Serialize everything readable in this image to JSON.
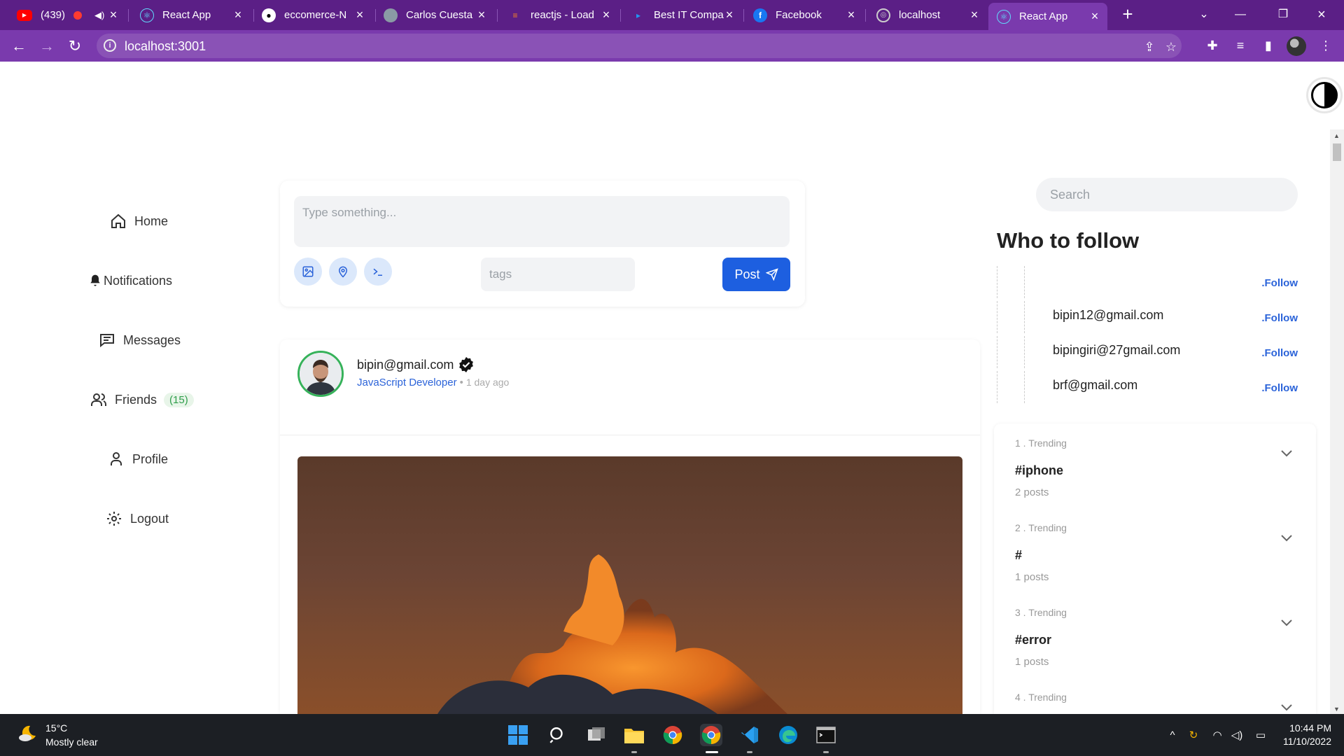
{
  "browser": {
    "tabs": [
      {
        "title": "(439)",
        "icon": "youtube-icon"
      },
      {
        "title": "React App",
        "icon": "react-icon"
      },
      {
        "title": "eccomerce-N",
        "icon": "github-icon"
      },
      {
        "title": "Carlos Cuesta",
        "icon": "avatar-icon"
      },
      {
        "title": "reactjs - Load",
        "icon": "stackoverflow-icon"
      },
      {
        "title": "Best IT Compa",
        "icon": "play-icon"
      },
      {
        "title": "Facebook",
        "icon": "facebook-icon"
      },
      {
        "title": "localhost",
        "icon": "globe-icon"
      },
      {
        "title": "React App",
        "icon": "react-icon"
      }
    ],
    "url": "localhost:3001"
  },
  "nav": {
    "home": "Home",
    "notifications": "Notifications",
    "messages": "Messages",
    "friends": "Friends",
    "friends_count": "(15)",
    "profile": "Profile",
    "logout": "Logout"
  },
  "composer": {
    "placeholder": "Type something...",
    "tags_placeholder": "tags",
    "post_label": "Post"
  },
  "post": {
    "author": "bipin@gmail.com",
    "role": "JavaScript Developer",
    "separator": "•",
    "time": "1 day ago"
  },
  "sidebar_right": {
    "search_placeholder": "Search",
    "who_to_follow_title": "Who to follow",
    "follow_label": ".Follow",
    "suggestions": [
      {
        "email": ""
      },
      {
        "email": "bipin12@gmail.com"
      },
      {
        "email": "bipingiri@27gmail.com"
      },
      {
        "email": "brf@gmail.com"
      }
    ]
  },
  "trending": [
    {
      "rank": "1 . Trending",
      "tag": "#iphone",
      "count": "2 posts"
    },
    {
      "rank": "2 . Trending",
      "tag": "#",
      "count": "1 posts"
    },
    {
      "rank": "3 . Trending",
      "tag": "#error",
      "count": "1 posts"
    },
    {
      "rank": "4 . Trending",
      "tag": "",
      "count": ""
    }
  ],
  "taskbar": {
    "temperature": "15°C",
    "condition": "Mostly clear",
    "time": "10:44 PM",
    "date": "11/10/2022"
  },
  "colors": {
    "tabbar": "#5b1f86",
    "addressbar": "#7a3aad",
    "primary": "#1d5fe0",
    "accent_green": "#36b25a"
  }
}
